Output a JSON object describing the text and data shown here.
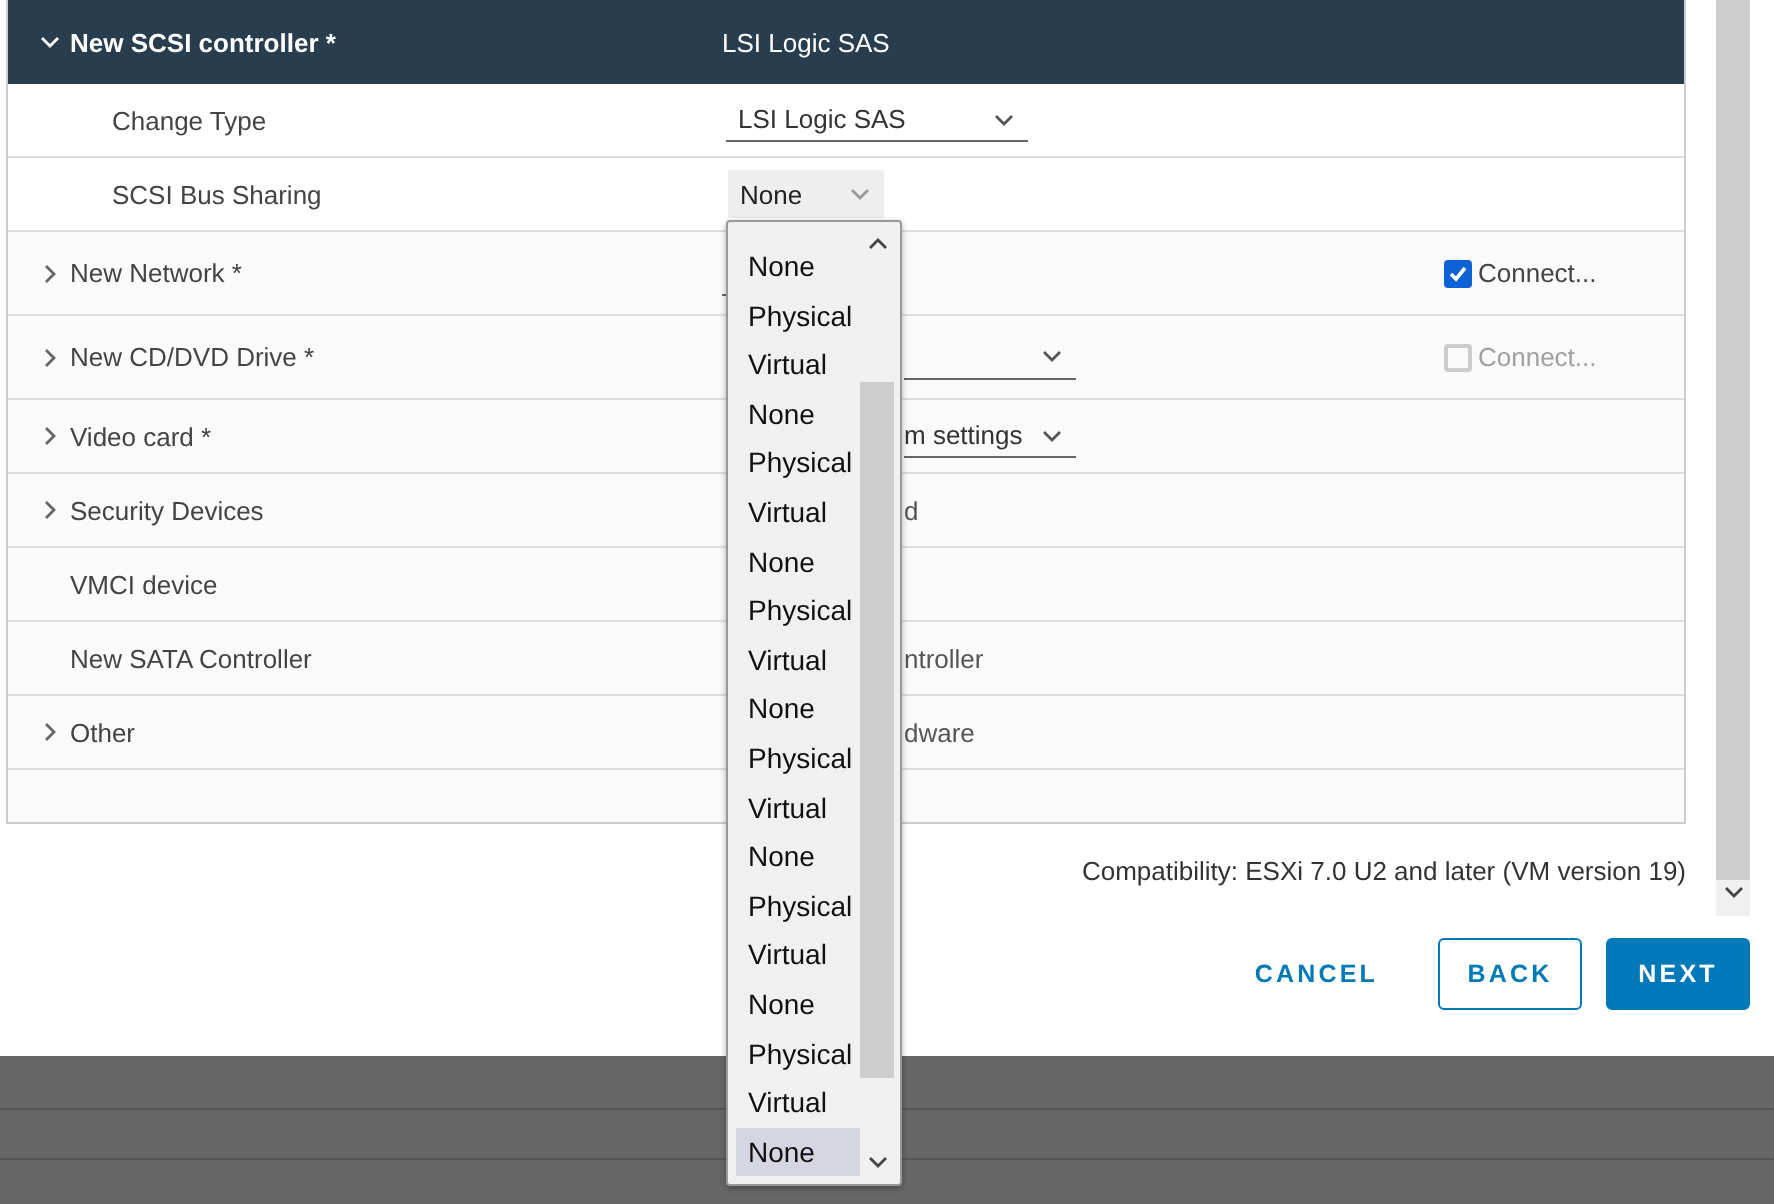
{
  "header": {
    "label": "New SCSI controller *",
    "value": "LSI Logic SAS",
    "expanded": true
  },
  "sub_rows": [
    {
      "label": "Change Type",
      "kind": "select",
      "value": "LSI Logic SAS"
    },
    {
      "label": "SCSI Bus Sharing",
      "kind": "box_select",
      "value": "None"
    }
  ],
  "rows": [
    {
      "label": "New Network *",
      "expanded": false,
      "kind": "field",
      "connect": {
        "label": "Connect...",
        "checked": true,
        "disabled": false
      }
    },
    {
      "label": "New CD/DVD Drive *",
      "expanded": false,
      "kind": "select",
      "connect": {
        "label": "Connect...",
        "checked": false,
        "disabled": true
      }
    },
    {
      "label": "Video card *",
      "expanded": false,
      "kind": "select",
      "value": "m settings"
    },
    {
      "label": "Security Devices",
      "expanded": false,
      "kind": "text",
      "value": "d"
    },
    {
      "label": "VMCI device",
      "kind": "none"
    },
    {
      "label": "New SATA Controller",
      "kind": "text",
      "value": "ntroller"
    },
    {
      "label": "Other",
      "expanded": false,
      "kind": "text",
      "value": "dware"
    }
  ],
  "bus_sharing_menu": {
    "options": [
      {
        "label": "None",
        "selected": false
      },
      {
        "label": "Physical",
        "selected": false
      },
      {
        "label": "Virtual",
        "selected": false
      },
      {
        "label": "None",
        "selected": false
      },
      {
        "label": "Physical",
        "selected": false
      },
      {
        "label": "Virtual",
        "selected": false
      },
      {
        "label": "None",
        "selected": false
      },
      {
        "label": "Physical",
        "selected": false
      },
      {
        "label": "Virtual",
        "selected": false
      },
      {
        "label": "None",
        "selected": false
      },
      {
        "label": "Physical",
        "selected": false
      },
      {
        "label": "Virtual",
        "selected": false
      },
      {
        "label": "None",
        "selected": false
      },
      {
        "label": "Physical",
        "selected": false
      },
      {
        "label": "Virtual",
        "selected": false
      },
      {
        "label": "None",
        "selected": false
      },
      {
        "label": "Physical",
        "selected": false
      },
      {
        "label": "Virtual",
        "selected": false
      },
      {
        "label": "None",
        "selected": true
      }
    ]
  },
  "compatibility": "Compatibility: ESXi 7.0 U2 and later (VM version 19)",
  "buttons": [
    {
      "label": "CANCEL",
      "kind": "flat"
    },
    {
      "label": "BACK",
      "kind": "outline"
    },
    {
      "label": "NEXT",
      "kind": "primary"
    }
  ]
}
